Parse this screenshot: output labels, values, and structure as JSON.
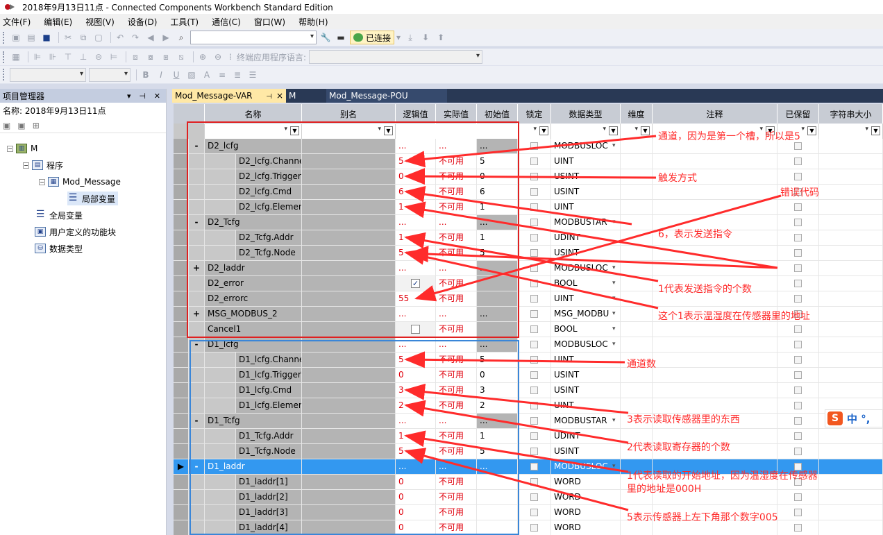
{
  "window": {
    "title": "2018年9月13日11点 - Connected Components Workbench Standard Edition"
  },
  "menu": [
    "文件(F)",
    "编辑(E)",
    "视图(V)",
    "设备(D)",
    "工具(T)",
    "通信(C)",
    "窗口(W)",
    "帮助(H)"
  ],
  "toolbar": {
    "connected_label": "已连接",
    "language_label": "终端应用程序语言:"
  },
  "project_panel": {
    "title": "项目管理器",
    "name_label": "名称:  2018年9月13日11点",
    "tree": [
      {
        "label": "M",
        "level": 0
      },
      {
        "label": "程序",
        "level": 1
      },
      {
        "label": "Mod_Message",
        "level": 2
      },
      {
        "label": "局部变量",
        "level": 3
      },
      {
        "label": "全局变量",
        "level": 1
      },
      {
        "label": "用户定义的功能块",
        "level": 1
      },
      {
        "label": "数据类型",
        "level": 1
      }
    ]
  },
  "tabs": [
    "Mod_Message-VAR",
    "M",
    "Mod_Message-POU"
  ],
  "tab_pin": "⊣",
  "tab_close": "×",
  "columns": [
    "名称",
    "别名",
    "逻辑值",
    "实际值",
    "初始值",
    "锁定",
    "数据类型",
    "维度",
    "注释",
    "已保留",
    "字符串大小"
  ],
  "rows": [
    {
      "exp": "-",
      "name": "D2_lcfg",
      "indent": 0,
      "logic": "...",
      "actual": "...",
      "init": "...",
      "type": "MODBUSLOC",
      "dd": true
    },
    {
      "exp": "",
      "name": "D2_lcfg.Channel",
      "indent": 1,
      "logic": "5",
      "actual": "不可用",
      "init": "5",
      "type": "UINT"
    },
    {
      "exp": "",
      "name": "D2_lcfg.TriggerT",
      "indent": 1,
      "logic": "0",
      "actual": "不可用",
      "init": "0",
      "type": "USINT"
    },
    {
      "exp": "",
      "name": "D2_lcfg.Cmd",
      "indent": 1,
      "logic": "6",
      "actual": "不可用",
      "init": "6",
      "type": "USINT"
    },
    {
      "exp": "",
      "name": "D2_lcfg.Element",
      "indent": 1,
      "logic": "1",
      "actual": "不可用",
      "init": "1",
      "type": "UINT"
    },
    {
      "exp": "-",
      "name": "D2_Tcfg",
      "indent": 0,
      "logic": "...",
      "actual": "...",
      "init": "...",
      "type": "MODBUSTAR",
      "dd": true
    },
    {
      "exp": "",
      "name": "D2_Tcfg.Addr",
      "indent": 1,
      "logic": "1",
      "actual": "不可用",
      "init": "1",
      "type": "UDINT"
    },
    {
      "exp": "",
      "name": "D2_Tcfg.Node",
      "indent": 1,
      "logic": "5",
      "actual": "不可用",
      "init": "5",
      "type": "USINT"
    },
    {
      "exp": "+",
      "name": "D2_laddr",
      "indent": 0,
      "logic": "...",
      "actual": "...",
      "init": "...",
      "type": "MODBUSLOC",
      "dd": true
    },
    {
      "exp": "",
      "name": "D2_error",
      "indent": 0,
      "logic": "checked",
      "actual": "不可用",
      "init": "",
      "type": "BOOL",
      "dd": true
    },
    {
      "exp": "",
      "name": "D2_errorc",
      "indent": 0,
      "logic": "55",
      "actual": "不可用",
      "init": "",
      "type": "UINT",
      "dd": true
    },
    {
      "exp": "+",
      "name": "MSG_MODBUS_2",
      "indent": 0,
      "logic": "...",
      "actual": "...",
      "init": "...",
      "type": "MSG_MODBU",
      "dd": true
    },
    {
      "exp": "",
      "name": "Cancel1",
      "indent": 0,
      "logic": "unchecked",
      "actual": "不可用",
      "init": "",
      "type": "BOOL",
      "dd": true
    },
    {
      "exp": "-",
      "name": "D1_lcfg",
      "indent": 0,
      "logic": "...",
      "actual": "...",
      "init": "...",
      "type": "MODBUSLOC",
      "dd": true
    },
    {
      "exp": "",
      "name": "D1_lcfg.Channel",
      "indent": 1,
      "logic": "5",
      "actual": "不可用",
      "init": "5",
      "type": "UINT"
    },
    {
      "exp": "",
      "name": "D1_lcfg.TriggerT",
      "indent": 1,
      "logic": "0",
      "actual": "不可用",
      "init": "0",
      "type": "USINT"
    },
    {
      "exp": "",
      "name": "D1_lcfg.Cmd",
      "indent": 1,
      "logic": "3",
      "actual": "不可用",
      "init": "3",
      "type": "USINT"
    },
    {
      "exp": "",
      "name": "D1_lcfg.Element",
      "indent": 1,
      "logic": "2",
      "actual": "不可用",
      "init": "2",
      "type": "UINT"
    },
    {
      "exp": "-",
      "name": "D1_Tcfg",
      "indent": 0,
      "logic": "...",
      "actual": "...",
      "init": "...",
      "type": "MODBUSTAR",
      "dd": true
    },
    {
      "exp": "",
      "name": "D1_Tcfg.Addr",
      "indent": 1,
      "logic": "1",
      "actual": "不可用",
      "init": "1",
      "type": "UDINT"
    },
    {
      "exp": "",
      "name": "D1_Tcfg.Node",
      "indent": 1,
      "logic": "5",
      "actual": "不可用",
      "init": "5",
      "type": "USINT"
    },
    {
      "exp": "-",
      "name": "D1_laddr",
      "indent": 0,
      "logic": "...",
      "actual": "...",
      "init": "...",
      "type": "MODBUSLOC",
      "dd": true,
      "selected": true
    },
    {
      "exp": "",
      "name": "D1_laddr[1]",
      "indent": 1,
      "logic": "0",
      "actual": "不可用",
      "init": "",
      "type": "WORD"
    },
    {
      "exp": "",
      "name": "D1_laddr[2]",
      "indent": 1,
      "logic": "0",
      "actual": "不可用",
      "init": "",
      "type": "WORD"
    },
    {
      "exp": "",
      "name": "D1_laddr[3]",
      "indent": 1,
      "logic": "0",
      "actual": "不可用",
      "init": "",
      "type": "WORD"
    },
    {
      "exp": "",
      "name": "D1_laddr[4]",
      "indent": 1,
      "logic": "0",
      "actual": "不可用",
      "init": "",
      "type": "WORD"
    }
  ],
  "annotations": [
    {
      "text": "通道，因为是第一个槽，所以是5"
    },
    {
      "text": "触发方式"
    },
    {
      "text": "错误代码"
    },
    {
      "text": "6，表示发送指令"
    },
    {
      "text": "1代表发送指令的个数"
    },
    {
      "text": "这个1表示温湿度在传感器里的地址"
    },
    {
      "text": "通道数"
    },
    {
      "text": "3表示读取传感器里的东西"
    },
    {
      "text": "2代表读取寄存器的个数"
    },
    {
      "text": "1代表读取的开始地址，因为温湿度在传感器"
    },
    {
      "text": "里的地址是000H"
    },
    {
      "text": "5表示传感器上左下角那个数字005"
    }
  ],
  "ime": {
    "logo": "S",
    "text": "中 °,"
  },
  "colors": {
    "annotation": "#ff2b2b",
    "red_box": "#e02020",
    "blue_box": "#3a86d8",
    "selected_row": "#3398f0"
  }
}
